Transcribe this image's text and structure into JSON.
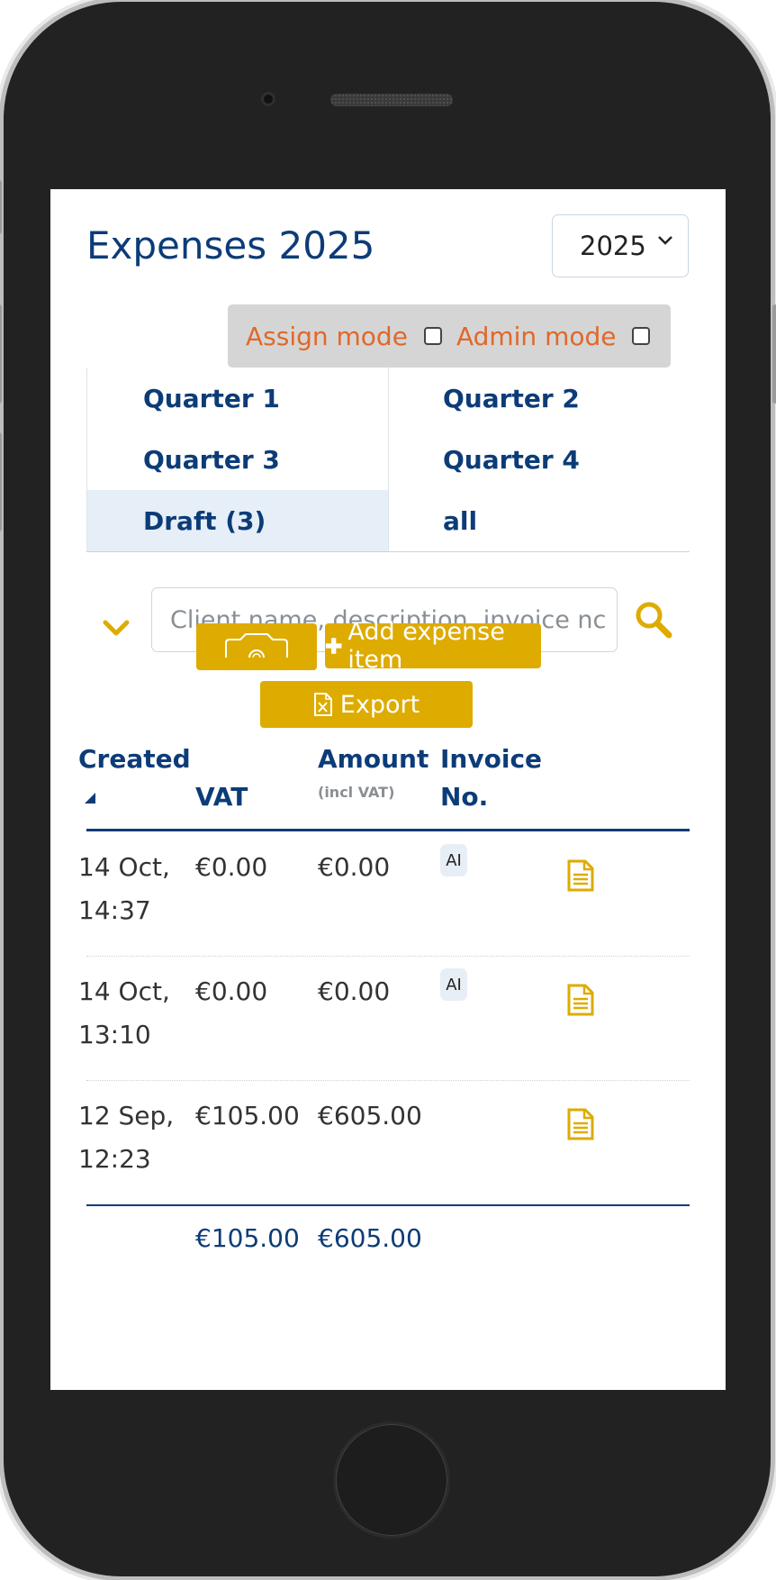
{
  "page": {
    "title": "Expenses 2025",
    "year_selected": "2025"
  },
  "modes": {
    "assign_label": "Assign mode",
    "admin_label": "Admin mode",
    "assign_checked": false,
    "admin_checked": false
  },
  "tabs": [
    {
      "label": "Quarter 1",
      "active": false
    },
    {
      "label": "Quarter 2",
      "active": false
    },
    {
      "label": "Quarter 3",
      "active": false
    },
    {
      "label": "Quarter 4",
      "active": false
    },
    {
      "label": "Draft (3)",
      "active": true
    },
    {
      "label": "all",
      "active": false
    }
  ],
  "search": {
    "placeholder": "Client name, description, invoice nc"
  },
  "toolbar": {
    "add_label": "Add expense item",
    "export_label": "Export",
    "accent_color": "#deab00"
  },
  "table": {
    "headers": {
      "created": "Created",
      "vat": "VAT",
      "amount": "Amount",
      "amount_sub": "(incl VAT)",
      "invoice": "Invoice",
      "invoice_2": "No."
    },
    "rows": [
      {
        "created_date": "14 Oct,",
        "created_time": "14:37",
        "vat": "€0.00",
        "amount": "€0.00",
        "badge": "AI"
      },
      {
        "created_date": "14 Oct,",
        "created_time": "13:10",
        "vat": "€0.00",
        "amount": "€0.00",
        "badge": "AI"
      },
      {
        "created_date": "12 Sep,",
        "created_time": "12:23",
        "vat": "€105.00",
        "amount": "€605.00",
        "badge": ""
      }
    ],
    "totals": {
      "vat": "€105.00",
      "amount": "€605.00"
    }
  },
  "colors": {
    "primary": "#0c3c78",
    "mode_text": "#e0682a",
    "accent": "#deab00"
  }
}
